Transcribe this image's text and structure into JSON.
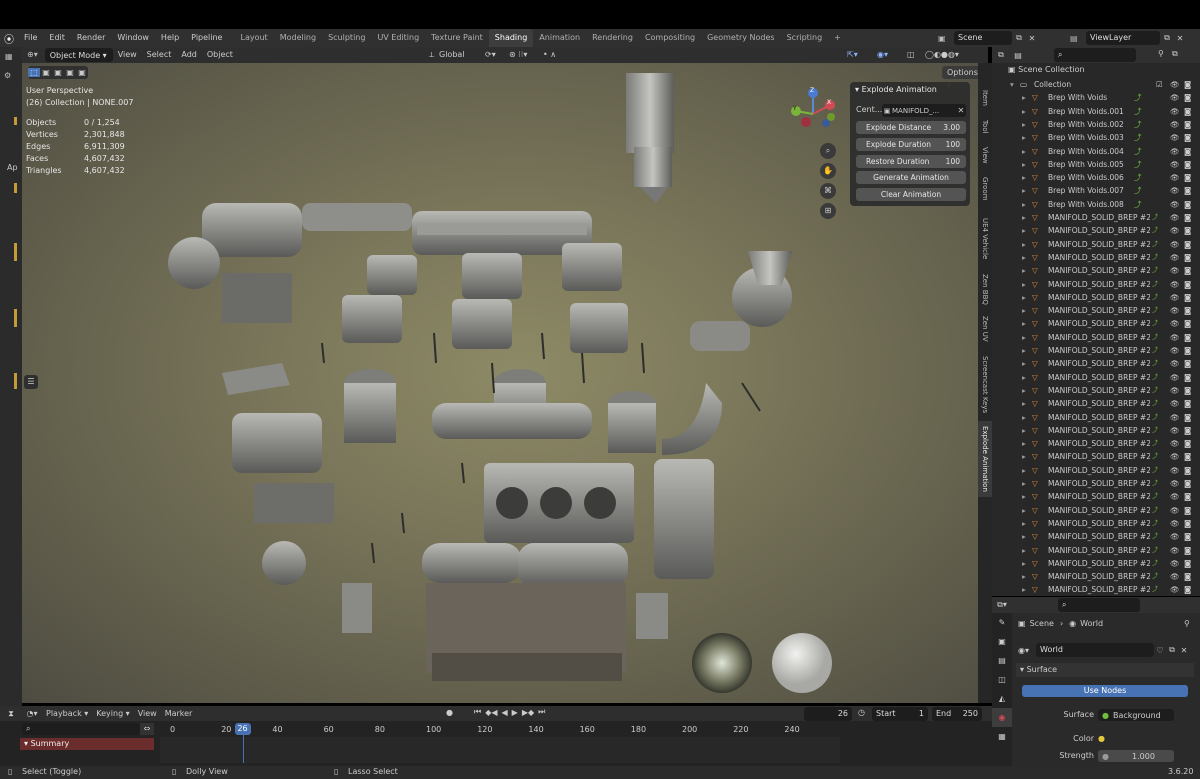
{
  "menu": [
    "File",
    "Edit",
    "Render",
    "Window",
    "Help",
    "Pipeline"
  ],
  "workspaces": [
    "Layout",
    "Modeling",
    "Sculpting",
    "UV Editing",
    "Texture Paint",
    "Shading",
    "Animation",
    "Rendering",
    "Compositing",
    "Geometry Nodes",
    "Scripting"
  ],
  "active_workspace": "Shading",
  "plus": "+",
  "scene": {
    "name": "Scene",
    "view_layer": "ViewLayer"
  },
  "viewport_header": {
    "mode": "Object Mode",
    "view": "View",
    "select": "Select",
    "add": "Add",
    "object": "Object",
    "orientation": "Global",
    "options": "Options"
  },
  "overlay": {
    "title": "User Perspective",
    "subtitle": "(26) Collection | NONE.007"
  },
  "stats": [
    {
      "label": "Objects",
      "value": "0 / 1,254"
    },
    {
      "label": "Vertices",
      "value": "2,301,848"
    },
    {
      "label": "Edges",
      "value": "6,911,309"
    },
    {
      "label": "Faces",
      "value": "4,607,432"
    },
    {
      "label": "Triangles",
      "value": "4,607,432"
    }
  ],
  "left_label": "Ap",
  "gizmo": {
    "x": "X",
    "y": "Y",
    "z": "Z"
  },
  "explode_panel": {
    "title": "Explode Animation",
    "center_label": "Cent...",
    "center_value": "MANIFOLD_...",
    "distance_label": "Explode Distance",
    "distance_value": "3.00",
    "duration_label": "Explode Duration",
    "duration_value": "100",
    "restore_label": "Restore Duration",
    "restore_value": "100",
    "generate": "Generate Animation",
    "clear": "Clear Animation"
  },
  "side_tabs": [
    "Item",
    "Tool",
    "View",
    "Groom",
    "UE4 Vehicle",
    "Zen BBQ",
    "Zen UV",
    "Screencast Keys",
    "Explode Animation"
  ],
  "outliner": {
    "root": "Scene Collection",
    "collection": "Collection",
    "items": [
      "Brep With Voids",
      "Brep With Voids.001",
      "Brep With Voids.002",
      "Brep With Voids.003",
      "Brep With Voids.004",
      "Brep With Voids.005",
      "Brep With Voids.006",
      "Brep With Voids.007",
      "Brep With Voids.008",
      "MANIFOLD_SOLID_BREP #218",
      "MANIFOLD_SOLID_BREP #218",
      "MANIFOLD_SOLID_BREP #218",
      "MANIFOLD_SOLID_BREP #218",
      "MANIFOLD_SOLID_BREP #218",
      "MANIFOLD_SOLID_BREP #218",
      "MANIFOLD_SOLID_BREP #221",
      "MANIFOLD_SOLID_BREP #221",
      "MANIFOLD_SOLID_BREP #221",
      "MANIFOLD_SOLID_BREP #222",
      "MANIFOLD_SOLID_BREP #222",
      "MANIFOLD_SOLID_BREP #222",
      "MANIFOLD_SOLID_BREP #222",
      "MANIFOLD_SOLID_BREP #222",
      "MANIFOLD_SOLID_BREP #222",
      "MANIFOLD_SOLID_BREP #222",
      "MANIFOLD_SOLID_BREP #222",
      "MANIFOLD_SOLID_BREP #222",
      "MANIFOLD_SOLID_BREP #222",
      "MANIFOLD_SOLID_BREP #222",
      "MANIFOLD_SOLID_BREP #222",
      "MANIFOLD_SOLID_BREP #222",
      "MANIFOLD_SOLID_BREP #222",
      "MANIFOLD_SOLID_BREP #222",
      "MANIFOLD_SOLID_BREP #222",
      "MANIFOLD_SOLID_BREP #223",
      "MANIFOLD_SOLID_BREP #223",
      "MANIFOLD_SOLID_BREP #223",
      "MANIFOLD_SOLID_BREP #230"
    ]
  },
  "properties": {
    "crumb_scene": "Scene",
    "crumb_world": "World",
    "world_name": "World",
    "section": "Surface",
    "use_nodes": "Use Nodes",
    "surface_label": "Surface",
    "surface_value": "Background",
    "color_label": "Color",
    "strength_label": "Strength",
    "strength_value": "1.000"
  },
  "timeline": {
    "playback": "Playback",
    "keying": "Keying",
    "view": "View",
    "marker": "Marker",
    "current_frame": "26",
    "start_label": "Start",
    "start": "1",
    "end_label": "End",
    "end": "250",
    "summary": "Summary",
    "ticks": [
      "0",
      "20",
      "40",
      "60",
      "80",
      "100",
      "120",
      "140",
      "160",
      "180",
      "200",
      "220",
      "240"
    ],
    "playhead": "26"
  },
  "status": {
    "select": "Select (Toggle)",
    "dolly": "Dolly View",
    "lasso": "Lasso Select",
    "version": "3.6.20"
  },
  "colors": {
    "accent": "#4772b3",
    "object_orange": "#e08b3a",
    "modifier_green": "#6fbf3a",
    "active_tab": "#3d3d3d",
    "summary_red": "#6b2c2c"
  }
}
